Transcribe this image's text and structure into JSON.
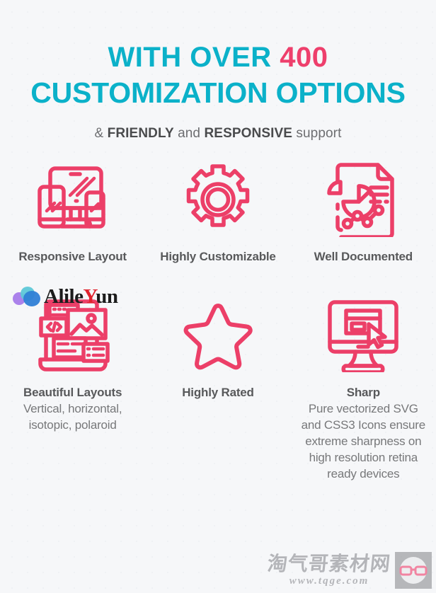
{
  "colors": {
    "background": "#f6f7f9",
    "title_cyan": "#0bb1c9",
    "accent_pink": "#ee3f6c",
    "icon_pink": "#ec3f68",
    "text_dark": "#58595b",
    "text_gray": "#77787a"
  },
  "header": {
    "title_line1_prefix": "WITH OVER ",
    "title_number": "400",
    "title_line2": "CUSTOMIZATION OPTIONS",
    "subtitle_part1": "& ",
    "subtitle_bold1": "FRIENDLY",
    "subtitle_part2": " and ",
    "subtitle_bold2": "RESPONSIVE",
    "subtitle_part3": " support"
  },
  "features": [
    {
      "icon": "responsive-devices-icon",
      "title": "Responsive\nLayout",
      "desc": ""
    },
    {
      "icon": "gear-icon",
      "title": "Highly\nCustomizable",
      "desc": ""
    },
    {
      "icon": "document-chart-icon",
      "title": "Well\nDocumented",
      "desc": ""
    },
    {
      "icon": "layouts-icon",
      "title": "Beautiful\nLayouts",
      "desc": "Vertical, horizontal,\nisotopic, polaroid"
    },
    {
      "icon": "star-icon",
      "title": "Highly\nRated",
      "desc": ""
    },
    {
      "icon": "monitor-cursor-icon",
      "title": "Sharp",
      "desc": "Pure vectorized SVG\nand CSS3 Icons ensure\nextreme sharpness on\nhigh resolution retina\nready devices"
    }
  ],
  "watermarks": {
    "alileyun": {
      "text_before": "Alile",
      "text_accent": "Y",
      "text_after": "un",
      "logo": "cloud-logo"
    },
    "tqge": {
      "chinese": "淘气哥素材网",
      "url": "www.tqge.com",
      "logo": "glasses-icon"
    }
  }
}
